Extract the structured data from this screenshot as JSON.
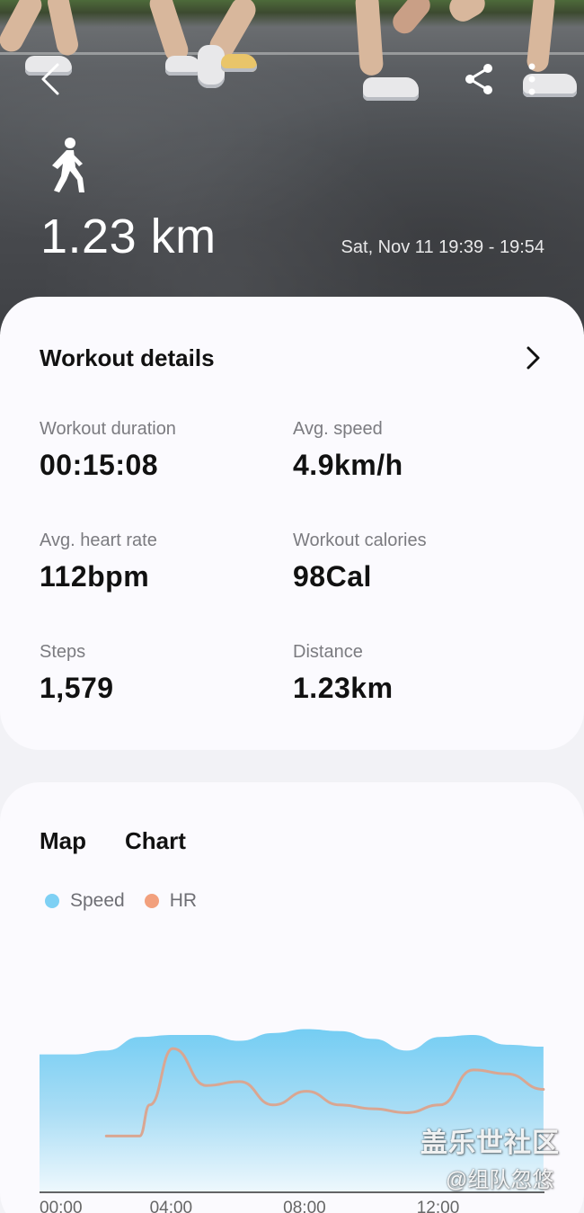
{
  "hero": {
    "distance": "1.23 km",
    "datetime": "Sat, Nov 11 19:39 - 19:54",
    "icons": {
      "back": "chevron-left-icon",
      "share": "share-icon",
      "more": "more-vertical-icon",
      "activity": "walking-person-icon"
    }
  },
  "details": {
    "title": "Workout details",
    "stats": [
      {
        "label": "Workout duration",
        "value": "00:15:08",
        "unit": ""
      },
      {
        "label": "Avg. speed",
        "value": "4.9",
        "unit": "km/h"
      },
      {
        "label": "Avg. heart rate",
        "value": "112",
        "unit": "bpm"
      },
      {
        "label": "Workout calories",
        "value": "98",
        "unit": "Cal"
      },
      {
        "label": "Steps",
        "value": "1,579",
        "unit": ""
      },
      {
        "label": "Distance",
        "value": "1.23",
        "unit": "km"
      }
    ]
  },
  "chart_section": {
    "tabs": [
      "Map",
      "Chart"
    ],
    "legend": [
      {
        "name": "Speed",
        "color": "#7ed0f4"
      },
      {
        "name": "HR",
        "color": "#f2a07d"
      }
    ]
  },
  "chart_data": {
    "type": "area",
    "x_ticks": [
      "00:00",
      "04:00",
      "08:00",
      "12:00"
    ],
    "x_range": [
      0,
      15.13
    ],
    "series": [
      {
        "name": "Speed",
        "x": [
          0,
          1,
          2,
          3,
          4,
          5,
          6,
          7,
          8,
          9,
          10,
          11,
          12,
          13,
          14,
          15.1
        ],
        "values": [
          0.71,
          0.71,
          0.73,
          0.8,
          0.81,
          0.81,
          0.78,
          0.82,
          0.84,
          0.83,
          0.79,
          0.73,
          0.8,
          0.81,
          0.76,
          0.75
        ]
      },
      {
        "name": "HR",
        "x": [
          2.0,
          3.0,
          3.3,
          4.0,
          5.0,
          6.0,
          7.0,
          8.0,
          9.0,
          10.0,
          11.0,
          12.0,
          13.0,
          14.0,
          15.1
        ],
        "values": [
          0.29,
          0.29,
          0.45,
          0.74,
          0.55,
          0.57,
          0.45,
          0.52,
          0.45,
          0.43,
          0.41,
          0.45,
          0.63,
          0.61,
          0.53
        ]
      }
    ]
  },
  "watermark": {
    "line1": "盖乐世社区",
    "line2": "@组队忽悠"
  }
}
